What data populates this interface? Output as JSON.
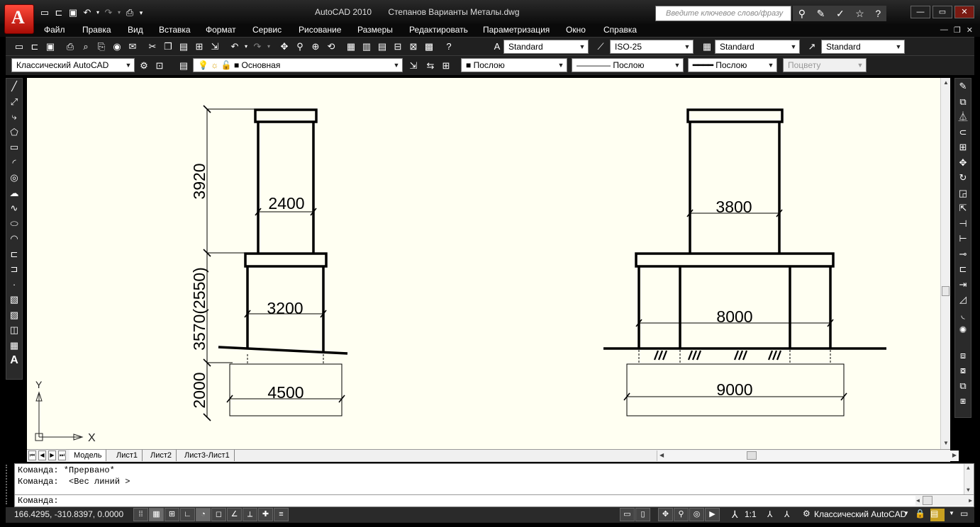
{
  "window": {
    "app_title": "AutoCAD 2010",
    "file_name": "Степанов Варианты Металы.dwg",
    "search_placeholder": "Введите ключевое слово/фразу"
  },
  "menu": [
    "Файл",
    "Правка",
    "Вид",
    "Вставка",
    "Формат",
    "Сервис",
    "Рисование",
    "Размеры",
    "Редактировать",
    "Параметризация",
    "Окно",
    "Справка"
  ],
  "toolbar": {
    "text_style": "Standard",
    "dim_style": "ISO-25",
    "table_style": "Standard",
    "mleader_style": "Standard",
    "workspace": "Классический AutoCAD",
    "layer": "Основная",
    "color": "Послою",
    "linetype": "Послою",
    "lineweight": "Послою",
    "plot_style": "Поцвету"
  },
  "drawing": {
    "left": {
      "dim_upper_height": "3920",
      "dim_mid_height": "3570(2550)",
      "dim_base_height": "2000",
      "dim_top_width": "2400",
      "dim_mid_width": "3200",
      "dim_base_width": "4500"
    },
    "right": {
      "dim_top_width": "3800",
      "dim_mid_width": "8000",
      "dim_base_width": "9000"
    },
    "ucs_x_label": "X",
    "ucs_y_label": "Y"
  },
  "tabs": [
    "Модель",
    "Лист1",
    "Лист2",
    "Лист3-Лист1"
  ],
  "command": {
    "history": [
      "Команда: *Прервано*",
      "Команда:  <Вес линий >"
    ],
    "prompt": "Команда:"
  },
  "status": {
    "coordinates": "166.4295, -310.8397, 0.0000",
    "scale": "1:1",
    "workspace": "Классический AutoCAD"
  },
  "colors": {
    "canvas_bg": "#fffff2",
    "chrome_bg": "#202020",
    "app_button": "#d41d10"
  }
}
